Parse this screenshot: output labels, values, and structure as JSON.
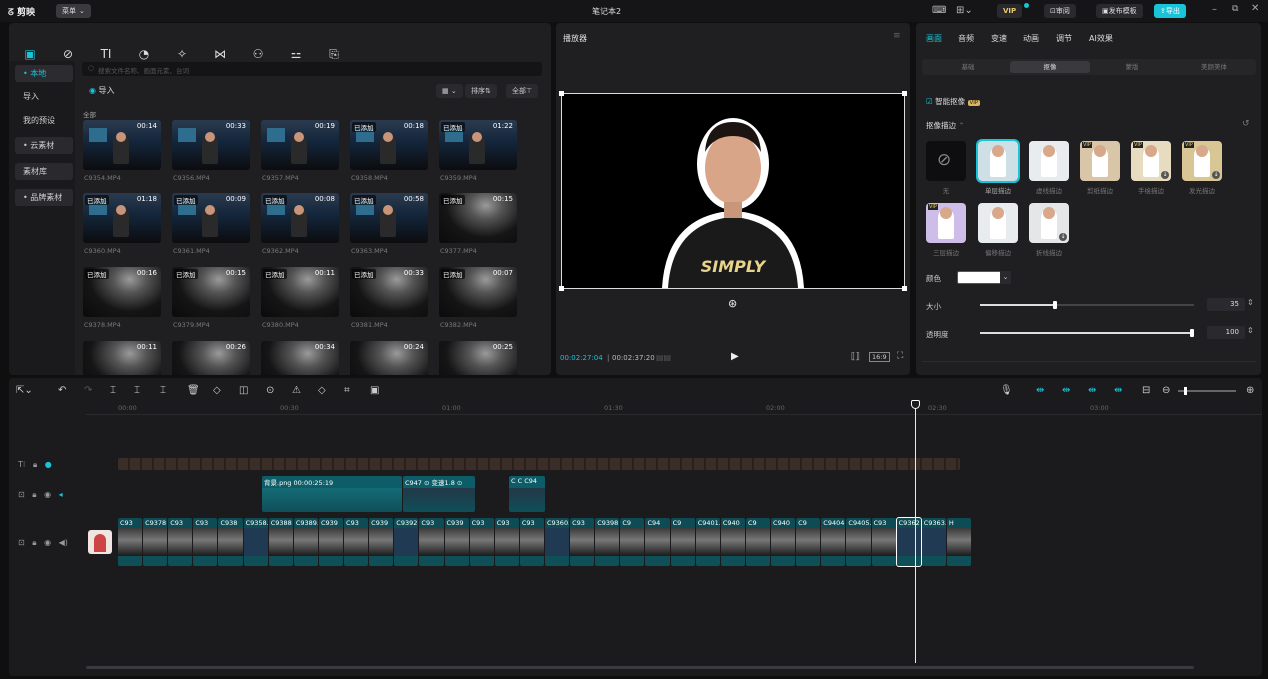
{
  "app": {
    "logo": "剪映",
    "menu_label": "菜单",
    "title": "笔记本2",
    "vip_label": "VIP",
    "review": "审阅",
    "publish_template": "发布模板",
    "export": "导出"
  },
  "media_tools": [
    {
      "label": "媒体",
      "icon": "media-icon"
    },
    {
      "label": "音频",
      "icon": "audio-icon"
    },
    {
      "label": "文本",
      "icon": "text-icon"
    },
    {
      "label": "贴纸",
      "icon": "sticker-icon"
    },
    {
      "label": "特效",
      "icon": "effects-icon"
    },
    {
      "label": "转场",
      "icon": "transition-icon"
    },
    {
      "label": "滤镜",
      "icon": "filter-icon"
    },
    {
      "label": "调节",
      "icon": "adjust-icon"
    },
    {
      "label": "模板",
      "icon": "template-icon"
    }
  ],
  "sidebar": {
    "items": [
      "• 本地",
      "导入",
      "我的预设",
      "• 云素材",
      "素材库",
      "• 品牌素材"
    ]
  },
  "library": {
    "search_placeholder": "搜索文件名称、画面元素、台词",
    "import_label": "导入",
    "sort_label": "排序",
    "all_label": "全部",
    "group_label": "全部",
    "added_tag": "已添加",
    "rows": [
      [
        {
          "name": "C9354.MP4",
          "dur": "00:14",
          "kind": "p",
          "added": false
        },
        {
          "name": "C9356.MP4",
          "dur": "00:33",
          "kind": "p",
          "added": false
        },
        {
          "name": "C9357.MP4",
          "dur": "00:19",
          "kind": "p",
          "added": false
        },
        {
          "name": "C9358.MP4",
          "dur": "00:18",
          "kind": "p",
          "added": true
        },
        {
          "name": "C9359.MP4",
          "dur": "01:22",
          "kind": "p",
          "added": true
        }
      ],
      [
        {
          "name": "C9360.MP4",
          "dur": "01:18",
          "kind": "p",
          "added": true
        },
        {
          "name": "C9361.MP4",
          "dur": "00:09",
          "kind": "p",
          "added": true
        },
        {
          "name": "C9362.MP4",
          "dur": "00:08",
          "kind": "p",
          "added": true
        },
        {
          "name": "C9363.MP4",
          "dur": "00:58",
          "kind": "p",
          "added": true
        },
        {
          "name": "C9377.MP4",
          "dur": "00:15",
          "kind": "c",
          "added": true
        }
      ],
      [
        {
          "name": "C9378.MP4",
          "dur": "00:16",
          "kind": "c",
          "added": true
        },
        {
          "name": "C9379.MP4",
          "dur": "00:15",
          "kind": "c",
          "added": true
        },
        {
          "name": "C9380.MP4",
          "dur": "00:11",
          "kind": "c",
          "added": true
        },
        {
          "name": "C9381.MP4",
          "dur": "00:33",
          "kind": "c",
          "added": true
        },
        {
          "name": "C9382.MP4",
          "dur": "00:07",
          "kind": "c",
          "added": true
        }
      ],
      [
        {
          "name": "",
          "dur": "00:11",
          "kind": "c",
          "added": false
        },
        {
          "name": "",
          "dur": "00:26",
          "kind": "c",
          "added": false
        },
        {
          "name": "",
          "dur": "00:34",
          "kind": "c",
          "added": false
        },
        {
          "name": "",
          "dur": "00:24",
          "kind": "c",
          "added": false
        },
        {
          "name": "",
          "dur": "00:25",
          "kind": "c",
          "added": false
        }
      ]
    ]
  },
  "player": {
    "title": "播放器",
    "current_time": "00:02:27:04",
    "total_time": "00:02:37:20",
    "ratio": "16:9",
    "shirt_text": "SIMPLY"
  },
  "inspector": {
    "tabs": [
      "画面",
      "音频",
      "变速",
      "动画",
      "调节",
      "AI效果"
    ],
    "subtabs": [
      "基础",
      "抠像",
      "蒙版",
      "美颜美体"
    ],
    "smart_cutout": "智能抠像",
    "stroke_title": "抠像描边",
    "strokes_row1": [
      "无",
      "单层描边",
      "虚线描边",
      "剪纸描边",
      "手绘描边",
      "发光描边"
    ],
    "strokes_row2": [
      "三层描边",
      "偏移描边",
      "折线描边"
    ],
    "color_label": "颜色",
    "size_label": "大小",
    "size_value": "35",
    "size_fraction": 0.35,
    "opacity_label": "透明度",
    "opacity_value": "100",
    "opacity_fraction": 1.0
  },
  "timeline": {
    "ruler": [
      "00:00",
      "00:30",
      "01:00",
      "01:30",
      "02:00",
      "02:30",
      "03:00"
    ],
    "overlay_clip_label": "背景.png  00:00:25:19",
    "overlay_clip2_label": "C947  ⊙ 变速1.8  ⊙",
    "overlay_clip3_label": "C  C  C94",
    "main_labels": [
      "C93",
      "C9378",
      "C93",
      "C93",
      "C938",
      "C9358.MP",
      "C9388",
      "C9389.MP4",
      "C939",
      "C93",
      "C939",
      "C9392.MP",
      "C93",
      "C939",
      "C93",
      "C93",
      "C93",
      "C9360.MP4",
      "C93",
      "C9398.",
      "C9",
      "C94",
      "C9",
      "C9401.M",
      "C940",
      "C9",
      "C940",
      "C9",
      "C9404",
      "C9405.",
      "C93",
      "C9362",
      "C9363.MP",
      "H"
    ]
  }
}
